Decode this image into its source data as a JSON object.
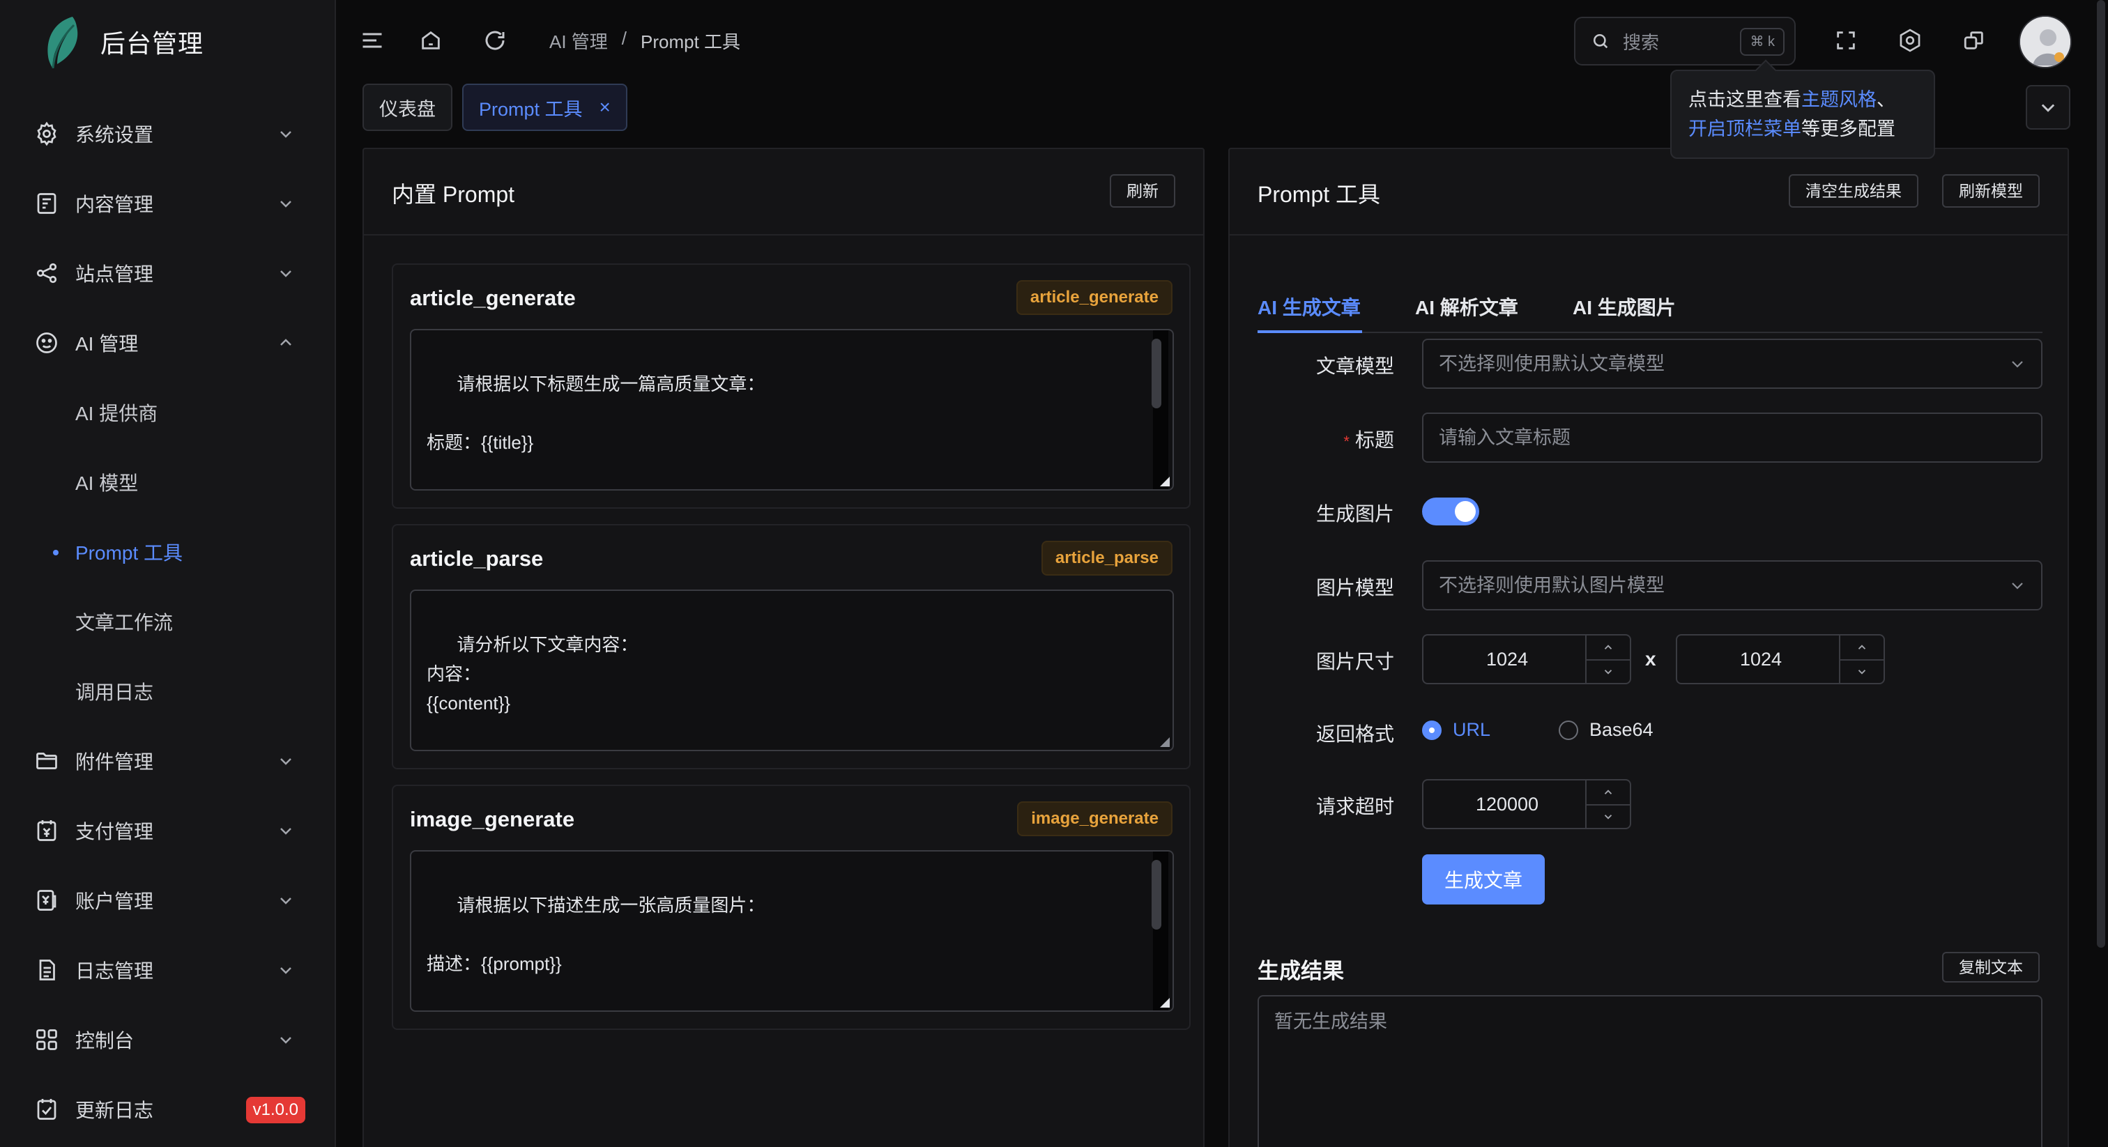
{
  "app": {
    "title": "后台管理"
  },
  "sidebar": {
    "items": [
      {
        "label": "系统设置",
        "icon": "gear-icon"
      },
      {
        "label": "内容管理",
        "icon": "content-icon"
      },
      {
        "label": "站点管理",
        "icon": "share-icon"
      },
      {
        "label": "AI 管理",
        "icon": "ai-icon"
      },
      {
        "label": "AI 提供商"
      },
      {
        "label": "AI 模型"
      },
      {
        "label": "Prompt 工具"
      },
      {
        "label": "文章工作流"
      },
      {
        "label": "调用日志"
      },
      {
        "label": "附件管理",
        "icon": "folder-icon"
      },
      {
        "label": "支付管理",
        "icon": "payment-icon"
      },
      {
        "label": "账户管理",
        "icon": "account-icon"
      },
      {
        "label": "日志管理",
        "icon": "log-icon"
      },
      {
        "label": "控制台",
        "icon": "grid-icon"
      },
      {
        "label": "更新日志",
        "icon": "changelog-icon",
        "badge": "v1.0.0"
      }
    ]
  },
  "breadcrumb": {
    "parent": "AI 管理",
    "separator": "/",
    "current": "Prompt 工具"
  },
  "search": {
    "placeholder": "搜索",
    "shortcut": "⌘ k"
  },
  "tooltip": {
    "text_before": "点击这里查看",
    "link1": "主题风格",
    "mid": "、",
    "link2": "开启顶栏菜单",
    "text_after": "等更多配置"
  },
  "tabs": [
    {
      "label": "仪表盘"
    },
    {
      "label": "Prompt 工具",
      "close": "×"
    }
  ],
  "left_card": {
    "title": "内置 Prompt",
    "refresh_label": "刷新",
    "prompts": [
      {
        "name": "article_generate",
        "tag": "article_generate",
        "text": "请根据以下标题生成一篇高质量文章：\n\n标题：{{title}}\n\n要求："
      },
      {
        "name": "article_parse",
        "tag": "article_parse",
        "text": "请分析以下文章内容：\n内容：\n{{content}}"
      },
      {
        "name": "image_generate",
        "tag": "image_generate",
        "text": "请根据以下描述生成一张高质量图片：\n\n描述：{{prompt}}\n\n要求："
      }
    ]
  },
  "right_card": {
    "title": "Prompt 工具",
    "clear_label": "清空生成结果",
    "refresh_models_label": "刷新模型",
    "tabs": [
      "AI 生成文章",
      "AI 解析文章",
      "AI 生成图片"
    ],
    "form": {
      "article_model_label": "文章模型",
      "article_model_placeholder": "不选择则使用默认文章模型",
      "title_required": "*",
      "title_label": "标题",
      "title_placeholder": "请输入文章标题",
      "gen_image_label": "生成图片",
      "image_model_label": "图片模型",
      "image_model_placeholder": "不选择则使用默认图片模型",
      "image_size_label": "图片尺寸",
      "width": "1024",
      "times": "x",
      "height": "1024",
      "return_format_label": "返回格式",
      "format_url": "URL",
      "format_base64": "Base64",
      "timeout_label": "请求超时",
      "timeout": "120000",
      "submit_label": "生成文章"
    },
    "result": {
      "title": "生成结果",
      "copy_label": "复制文本",
      "placeholder": "暂无生成结果"
    }
  },
  "colors": {
    "accent": "#5b8cff",
    "tag_orange": "#e8a33c",
    "badge_red": "#e53935"
  }
}
